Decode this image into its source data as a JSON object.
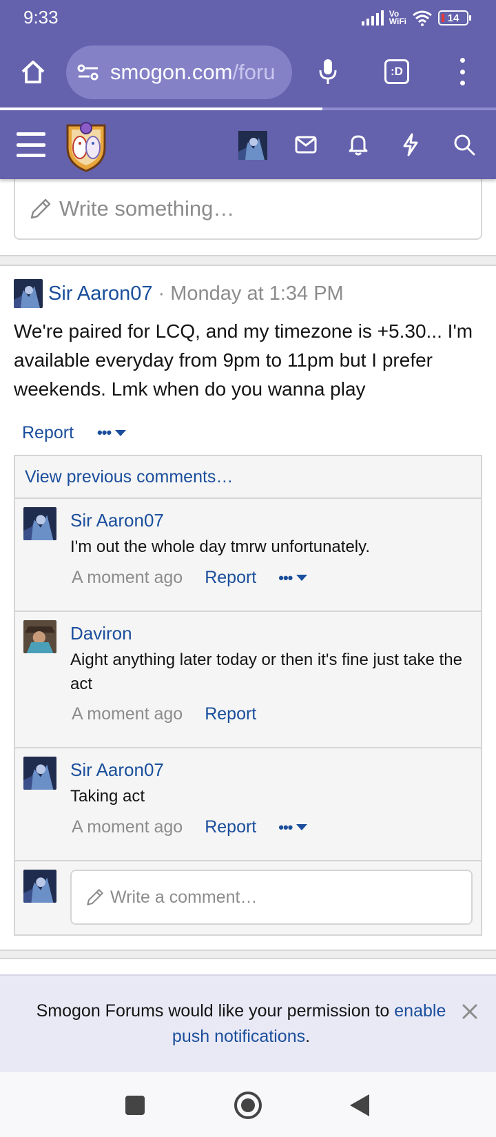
{
  "status_bar": {
    "time": "9:33",
    "network": "Vo WiFi",
    "battery": "14"
  },
  "browser": {
    "url_host": "smogon.com",
    "url_path": "/foru",
    "tabs_label": ":D",
    "load_progress": 0.65
  },
  "site_header": {
    "icons": [
      "menu-icon",
      "site-logo",
      "user-avatar",
      "inbox-icon",
      "bell-icon",
      "bolt-icon",
      "search-icon"
    ]
  },
  "status_update": {
    "placeholder": "Write something…"
  },
  "post": {
    "author": "Sir Aaron07",
    "separator": "·",
    "time": "Monday at 1:34 PM",
    "body": "We're paired for LCQ, and my timezone is +5.30... I'm available everyday from 9pm to 11pm but I prefer weekends. Lmk when do you wanna play",
    "report_label": "Report",
    "more_label": "•••"
  },
  "comments": {
    "view_previous": "View previous comments…",
    "items": [
      {
        "author": "Sir Aaron07",
        "text": "I'm out the whole day tmrw unfortunately.",
        "time": "A moment ago",
        "report_label": "Report",
        "more_label": "•••"
      },
      {
        "author": "Daviron",
        "text": "Aight anything later today or then it's fine just take the act",
        "time": "A moment ago",
        "report_label": "Report"
      },
      {
        "author": "Sir Aaron07",
        "text": "Taking act",
        "time": "A moment ago",
        "report_label": "Report",
        "more_label": "•••"
      }
    ],
    "write_placeholder": "Write a comment…"
  },
  "push_notice": {
    "text_before": "Smogon Forums would like your permission to ",
    "link_text": "enable push notifications",
    "text_after": "."
  },
  "colors": {
    "brand": "#6461ad",
    "link": "#1a4e9c",
    "muted": "#8c8c8c"
  }
}
